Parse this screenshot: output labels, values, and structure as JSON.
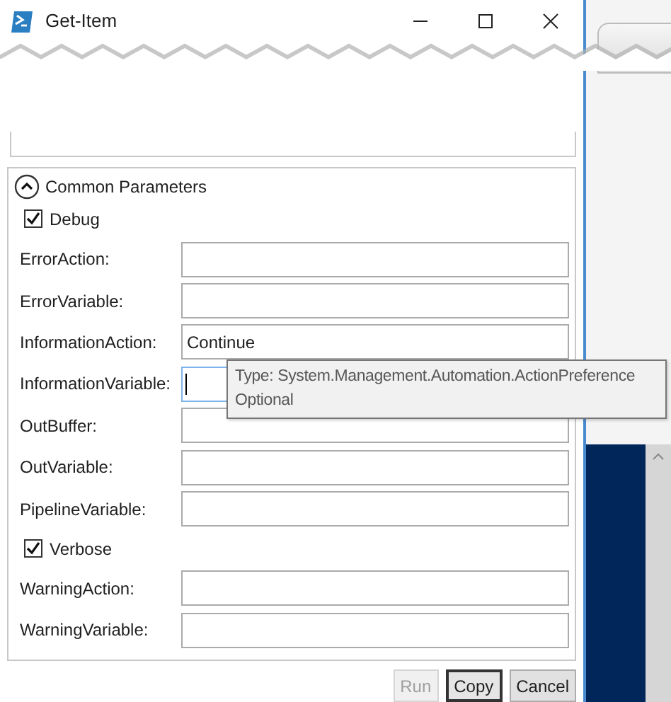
{
  "window": {
    "title": "Get-Item"
  },
  "common_parameters": {
    "title": "Common Parameters",
    "expanded": true,
    "parameters": [
      {
        "kind": "checkbox",
        "label": "Debug",
        "checked": true
      },
      {
        "kind": "text",
        "label": "ErrorAction:"
      },
      {
        "kind": "text",
        "label": "ErrorVariable:"
      },
      {
        "kind": "text",
        "label": "InformationAction:",
        "value": "Continue",
        "focused": false
      },
      {
        "kind": "text",
        "label": "InformationVariable:",
        "focused": true
      },
      {
        "kind": "text",
        "label": "OutBuffer:"
      },
      {
        "kind": "text",
        "label": "OutVariable:"
      },
      {
        "kind": "text",
        "label": "PipelineVariable:"
      },
      {
        "kind": "checkbox",
        "label": "Verbose",
        "checked": true
      },
      {
        "kind": "text",
        "label": "WarningAction:"
      },
      {
        "kind": "text",
        "label": "WarningVariable:"
      }
    ]
  },
  "tooltip": {
    "lines": [
      "Type: System.Management.Automation.ActionPreference",
      "Optional"
    ]
  },
  "buttons": [
    {
      "label": "Run",
      "disabled": true,
      "default": false
    },
    {
      "label": "Copy",
      "disabled": false,
      "default": true
    },
    {
      "label": "Cancel",
      "disabled": false,
      "default": false
    }
  ]
}
